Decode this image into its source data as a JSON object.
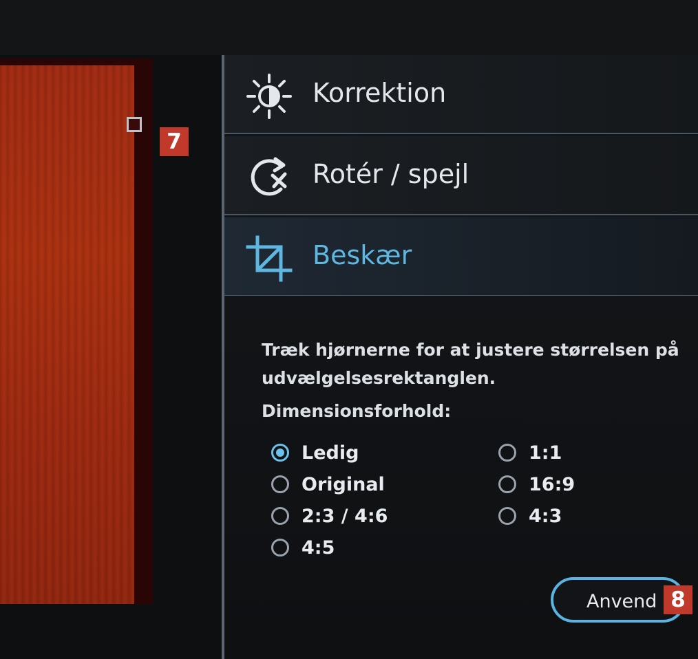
{
  "canvas": {
    "callout_crop_corner": "7"
  },
  "sidebar": {
    "sections": [
      {
        "label": "Korrektion",
        "icon": "brightness-icon",
        "active": false
      },
      {
        "label": "Rotér / spejl",
        "icon": "rotate-flip-icon",
        "active": false
      },
      {
        "label": "Beskær",
        "icon": "crop-icon",
        "active": true
      }
    ]
  },
  "crop": {
    "instructions": "Træk hjørnerne for at justere størrelsen på udvælgelsesrektanglen.",
    "aspect_label": "Dimensionsforhold:",
    "options": [
      {
        "label": "Ledig",
        "checked": true
      },
      {
        "label": "Original",
        "checked": false
      },
      {
        "label": "2:3 / 4:6",
        "checked": false
      },
      {
        "label": "4:5",
        "checked": false
      },
      {
        "label": "1:1",
        "checked": false
      },
      {
        "label": "16:9",
        "checked": false
      },
      {
        "label": "4:3",
        "checked": false
      }
    ],
    "apply_label": "Anvend",
    "callout_apply": "8"
  },
  "colors": {
    "accent": "#5fb6df",
    "callout": "#c0392b",
    "photo": "#a02c10"
  }
}
